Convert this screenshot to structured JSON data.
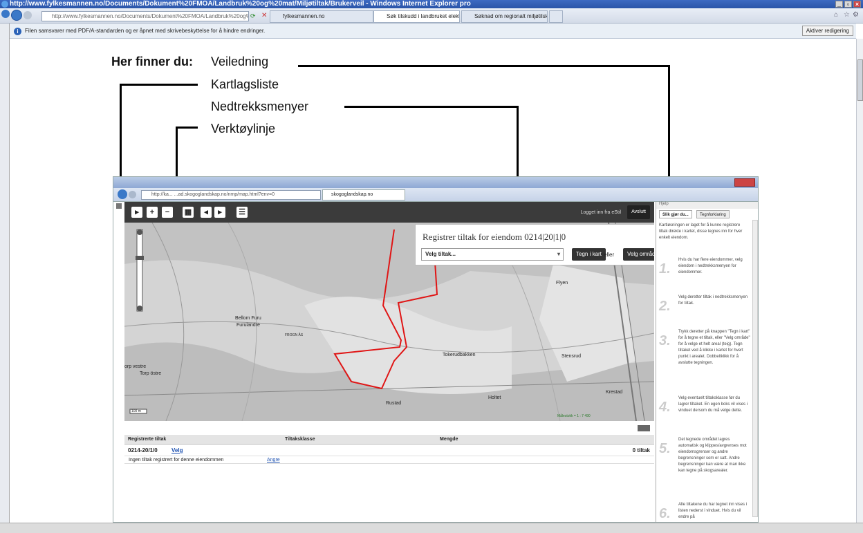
{
  "window": {
    "title": "http://www.fylkesmannen.no/Documents/Dokument%20FMOA/Landbruk%20og%20mat/Miljøtiltak/Brukerveil - Windows Internet Explorer pro"
  },
  "browser": {
    "address": "http://www.fylkesmannen.no/Documents/Dokument%20FMOA/Landbruk%20og%20mat",
    "tabs": [
      "fylkesmannen.no",
      "Søk tilskudd i landbruket elektro...",
      "Søknad om regionalt miljøtilskudd"
    ]
  },
  "infobar": {
    "message": "Filen samsvarer med PDF/A-standarden og er åpnet med skrivebeskyttelse for å hindre endringer.",
    "button": "Aktiver redigering"
  },
  "legend": {
    "intro": "Her finner du:",
    "items": [
      "Veiledning",
      "Kartlagsliste",
      "Nedtrekksmenyer",
      "Verktøylinje"
    ]
  },
  "inner": {
    "address": "http://ka...  ...ad.skogoglandskap.no/nmp/map.html?env=0",
    "tab": "skogoglandskap.no",
    "toolbar": {
      "logged_in": "Logget inn fra eStil",
      "exit": "Avslutt"
    },
    "register": {
      "title": "Registrer tiltak for eiendom 0214|20|1|0",
      "select": "Velg tiltak...",
      "draw": "Tegn i kart",
      "or": "eller",
      "area": "Velg område"
    },
    "map_labels": [
      "Bellom Furu",
      "Furulandre",
      "FROGN ÅS",
      "orp vestre",
      "Torp östre",
      "Tokerudbakken",
      "Flyen",
      "Stensrud",
      "Holtet",
      "Rustad",
      "Krestad",
      "Målestokk = 1 : 7 490",
      "100 m"
    ],
    "table": {
      "headers": [
        "Registrerte tiltak",
        "Tiltaksklasse",
        "Mengde"
      ],
      "row": {
        "id": "0214-20/1/0",
        "link": "Velg",
        "count": "0 tiltak"
      },
      "empty": "Ingen tiltak registrert for denne eiendommen",
      "change": "Angre"
    },
    "side": {
      "header": "Hjelp",
      "tabs": [
        "Slik gjør du...",
        "Tegnforklaring"
      ],
      "intro": "Kartløsningen er laget for å kunne registrere tiltak direkte i kartet, disse tegnes inn for hver enkelt eiendom.",
      "steps": [
        {
          "n": "1.",
          "text": "Hvis du har flere eiendommer, velg eiendom i nedtrekksmenyen for eiendommer."
        },
        {
          "n": "2.",
          "text": "Velg deretter tiltak i nedtrekksmenyen for tiltak."
        },
        {
          "n": "3.",
          "text": "Trykk deretter på knappen \"Tegn i kart\" for å tegne et tiltak, eller \"Velg område\" for å velge et helt areal (teig). Tegn tiltaket ved å klikke i kartet for hvert punkt i arealet. Dobbeltklikk for å avslutte tegningen."
        },
        {
          "n": "4.",
          "text": "Velg eventuelt tiltaksklasse før du lagrer tiltaket. En egen boks vil vises i vinduet dersom du må velge dette."
        },
        {
          "n": "5.",
          "text": "Det tegnede området lagres automatisk og klippes/avgrenses mot eiendomsgrenser og andre begrensninger som er satt. Andre begrensninger kan være at man ikke kan tegne på skogsarealer."
        },
        {
          "n": "6.",
          "text": "Alle tiltakene du har tegnet inn vises i listen nederst i vinduet. Hvis du vil endre på"
        }
      ]
    }
  }
}
